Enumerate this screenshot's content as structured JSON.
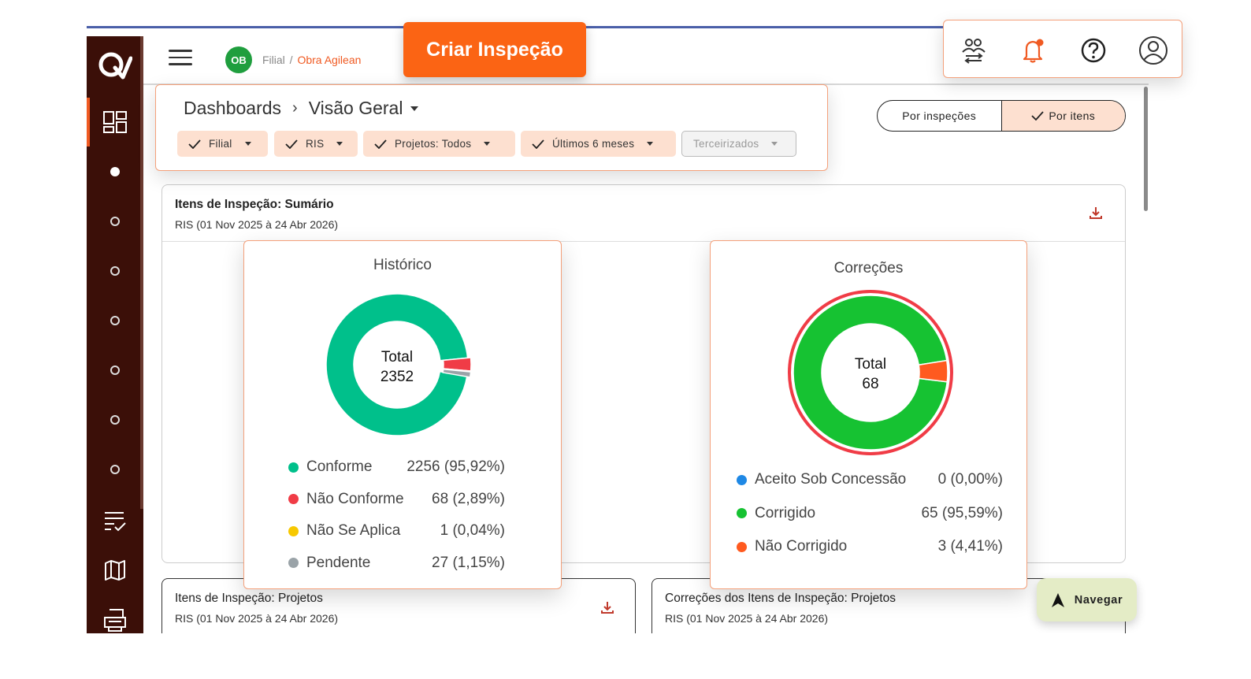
{
  "header": {
    "project_initials": "OB",
    "branch": "Filial",
    "separator": "/",
    "project_name": "Obra Agilean",
    "create_button": "Criar Inspeção"
  },
  "breadcrumb": {
    "root": "Dashboards",
    "current": "Visão Geral"
  },
  "filters": [
    {
      "label": "Filial",
      "active": true
    },
    {
      "label": "RIS",
      "active": true
    },
    {
      "label": "Projetos: Todos",
      "active": true
    },
    {
      "label": "Últimos 6 meses",
      "active": true
    },
    {
      "label": "Terceirizados",
      "active": false
    }
  ],
  "view_toggle": {
    "option_a": "Por inspeções",
    "option_b": "Por itens",
    "selected": "Por itens"
  },
  "summary_card": {
    "title": "Itens de Inspeção: Sumário",
    "subtitle": "RIS (01 Nov 2025 à 24 Abr 2026)"
  },
  "chart_data": [
    {
      "type": "pie",
      "title": "Histórico",
      "center_label": "Total",
      "center_value": "2352",
      "categories": [
        "Conforme",
        "Não Conforme",
        "Não Se Aplica",
        "Pendente"
      ],
      "values": [
        2256,
        68,
        1,
        27
      ],
      "labels": [
        "2256 (95,92%)",
        "68 (2,89%)",
        "1 (0,04%)",
        "27 (1,15%)"
      ],
      "colors": [
        "#00c08b",
        "#f03c46",
        "#f7c800",
        "#9aa3a8"
      ]
    },
    {
      "type": "pie",
      "title": "Correções",
      "center_label": "Total",
      "center_value": "68",
      "categories": [
        "Aceito Sob Concessão",
        "Corrigido",
        "Não Corrigido"
      ],
      "values": [
        0,
        65,
        3
      ],
      "labels": [
        "0 (0,00%)",
        "65 (95,59%)",
        "3 (4,41%)"
      ],
      "colors": [
        "#1e88e5",
        "#16c232",
        "#ff5a1f"
      ],
      "outer_ring_color": "#f03c46"
    }
  ],
  "bottom_cards": [
    {
      "title": "Itens de Inspeção: Projetos",
      "subtitle": "RIS (01 Nov 2025 à 24 Abr 2026)"
    },
    {
      "title": "Correções dos Itens de Inspeção: Projetos",
      "subtitle": "RIS (01 Nov 2025 à 24 Abr 2026)"
    }
  ],
  "navigate_button": "Navegar",
  "colors": {
    "brand_orange": "#fb6414",
    "sidebar_bg": "#3b0f08",
    "chip_bg": "#fde0d0",
    "accent_border": "#f4a07a"
  },
  "icons": {
    "sidebar": [
      "logo-q-icon",
      "dashboard-icon",
      "checklist-icon",
      "map-icon",
      "printer-icon"
    ],
    "header": [
      "team-swap-icon",
      "bell-notification-icon",
      "help-icon",
      "user-account-icon"
    ]
  }
}
